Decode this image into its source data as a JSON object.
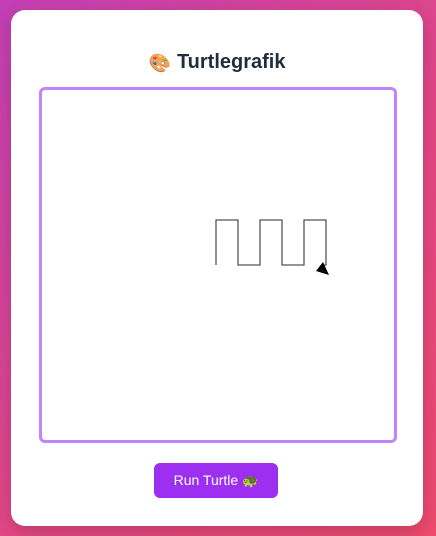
{
  "header": {
    "icon": "palette-icon",
    "icon_glyph": "🎨",
    "title": "Turtlegrafik"
  },
  "canvas": {
    "border_color": "#c084fc",
    "stroke_color": "#555555",
    "turtle_color": "#000000"
  },
  "actions": {
    "run_label": "Run Turtle",
    "run_icon": "turtle-icon",
    "run_glyph": "🐢",
    "button_color": "#9d2ff0"
  }
}
